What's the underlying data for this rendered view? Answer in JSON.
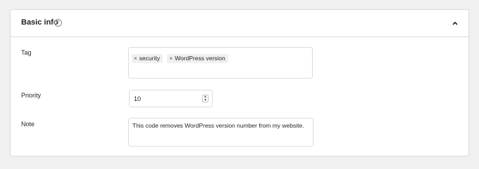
{
  "panel": {
    "title": "Basic info",
    "help_icon": "question-circle-icon",
    "toggle_icon": "chevron-up-icon"
  },
  "fields": {
    "tag": {
      "label": "Tag",
      "chips": [
        {
          "remove": "×",
          "label": "security"
        },
        {
          "remove": "×",
          "label": "WordPress version"
        }
      ]
    },
    "priority": {
      "label": "Priority",
      "value": "10",
      "spinner_icon": "up-down-spinner-icon"
    },
    "note": {
      "label": "Note",
      "value": "This code removes WordPress version number from my website."
    }
  },
  "colors": {
    "page_bg": "#f0f0f1",
    "panel_bg": "#ffffff",
    "border": "#dcdcde",
    "chip_bg": "#f0f0f1",
    "text": "#1d2327"
  }
}
